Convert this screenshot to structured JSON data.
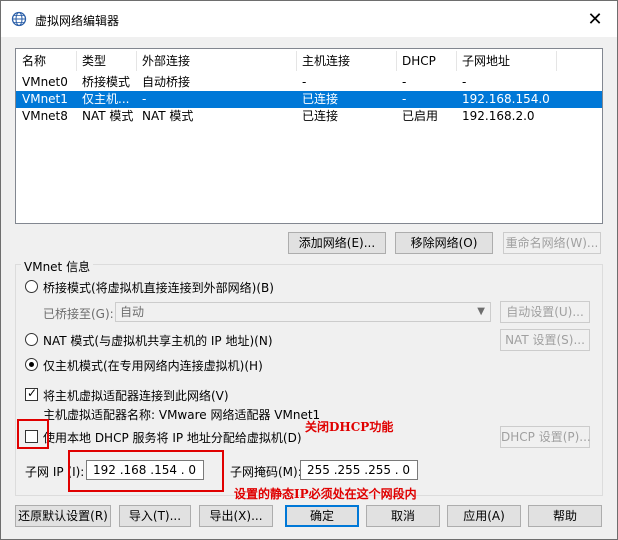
{
  "window": {
    "title": "虚拟网络编辑器",
    "close_symbol": "✕"
  },
  "list": {
    "headers": [
      "名称",
      "类型",
      "外部连接",
      "主机连接",
      "DHCP",
      "子网地址"
    ],
    "rows": [
      {
        "name": "VMnet0",
        "type": "桥接模式",
        "external": "自动桥接",
        "host": "-",
        "dhcp": "-",
        "subnet": "-"
      },
      {
        "name": "VMnet1",
        "type": "仅主机...",
        "external": "-",
        "host": "已连接",
        "dhcp": "-",
        "subnet": "192.168.154.0",
        "selected": true
      },
      {
        "name": "VMnet8",
        "type": "NAT 模式",
        "external": "NAT 模式",
        "host": "已连接",
        "dhcp": "已启用",
        "subnet": "192.168.2.0"
      }
    ]
  },
  "list_buttons": {
    "add": "添加网络(E)...",
    "remove": "移除网络(O)",
    "rename": "重命名网络(W)..."
  },
  "vmnet_info": {
    "group_label": "VMnet 信息",
    "bridged": {
      "label": "桥接模式(将虚拟机直接连接到外部网络)(B)",
      "bridged_to_label": "已桥接至(G):",
      "bridged_to_value": "自动",
      "auto_settings": "自动设置(U)..."
    },
    "nat": {
      "label": "NAT 模式(与虚拟机共享主机的 IP 地址)(N)",
      "settings": "NAT 设置(S)..."
    },
    "host_only": {
      "label": "仅主机模式(在专用网络内连接虚拟机)(H)"
    },
    "connect_adapter": {
      "label": "将主机虚拟适配器连接到此网络(V)",
      "adapter_name": "主机虚拟适配器名称: VMware 网络适配器 VMnet1"
    },
    "dhcp": {
      "label": "使用本地 DHCP 服务将 IP 地址分配给虚拟机(D)",
      "settings": "DHCP 设置(P)..."
    },
    "subnet_ip_label": "子网 IP (I):",
    "subnet_ip": "192 .168 .154 . 0",
    "subnet_mask_label": "子网掩码(M):",
    "subnet_mask": "255 .255 .255 . 0"
  },
  "annotations": {
    "dhcp_off": "关闭DHCP功能",
    "static_ip": "设置的静态IP必须处在这个网段内"
  },
  "footer": {
    "restore": "还原默认设置(R)",
    "import": "导入(T)...",
    "export": "导出(X)...",
    "ok": "确定",
    "cancel": "取消",
    "apply": "应用(A)",
    "help": "帮助"
  },
  "colors": {
    "selection": "#0078d7",
    "annotation_red": "#e00000",
    "default_button_border": "#0078d7"
  }
}
